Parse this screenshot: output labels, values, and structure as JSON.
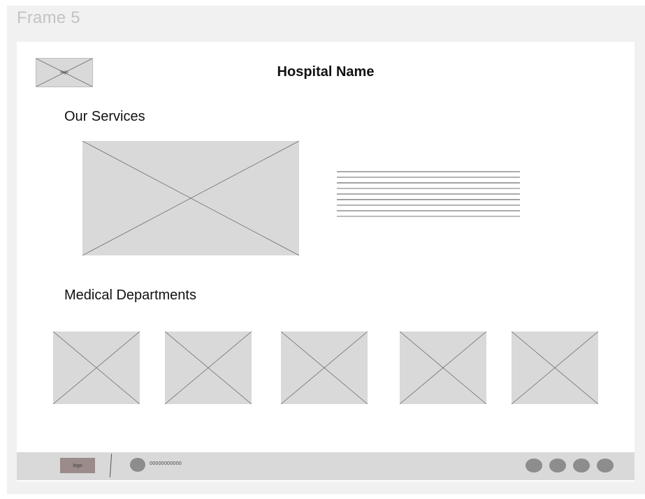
{
  "frame": {
    "label": "Frame 5"
  },
  "header": {
    "logo_label": "logo",
    "title": "Hospital Name"
  },
  "services": {
    "heading": "Our Services"
  },
  "departments": {
    "heading": "Medical Departments",
    "items": [
      "dept-1",
      "dept-2",
      "dept-3",
      "dept-4",
      "dept-5"
    ]
  },
  "footer": {
    "logo_label": "logo",
    "phone": "00000000000",
    "social_icons": [
      "social-icon-1",
      "social-icon-2",
      "social-icon-3",
      "social-icon-4"
    ]
  },
  "colors": {
    "placeholder_fill": "#d9d9d9",
    "placeholder_stroke": "#7a7a7a",
    "frame_bg": "#f1f1f1",
    "footer_bg": "#d9d9d9",
    "footer_logo_bg": "#9b8b8b",
    "social_icon": "#8d8d8d"
  }
}
